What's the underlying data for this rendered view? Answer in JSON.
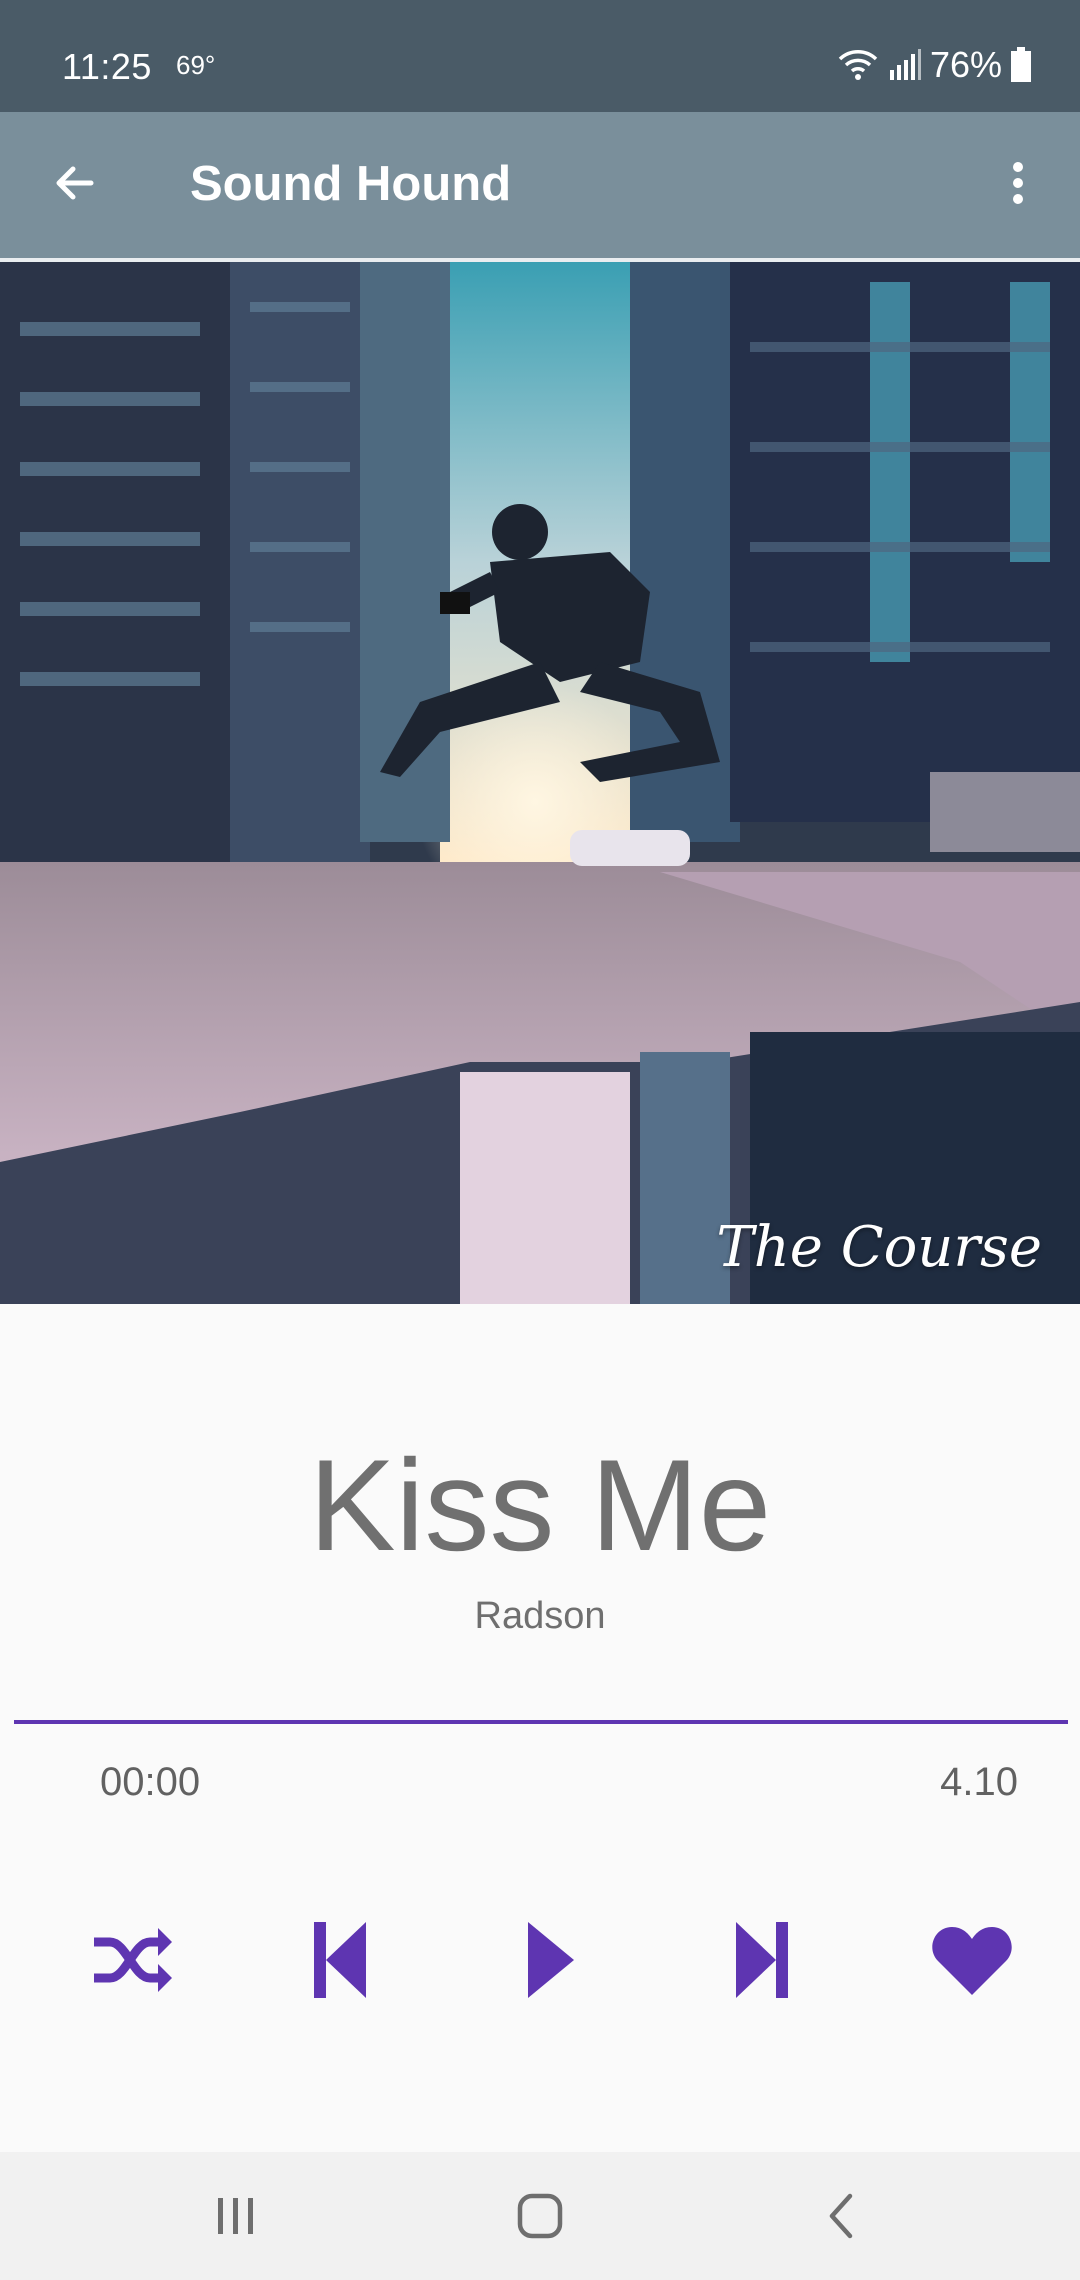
{
  "status_bar": {
    "time": "11:25",
    "temperature": "69°",
    "battery": "76%",
    "icons": [
      "wifi-icon",
      "signal-icon",
      "battery-icon"
    ]
  },
  "app_bar": {
    "title": "Sound Hound",
    "back_icon": "arrow-left-icon",
    "menu_icon": "more-vertical-icon",
    "background": "#7a8f9b"
  },
  "album": {
    "caption": "The Course"
  },
  "track": {
    "title": "Kiss Me",
    "artist": "Radson",
    "current_time": "00:00",
    "total_time": "4.10",
    "progress": 0
  },
  "controls": {
    "accent": "#5e35b1",
    "buttons": [
      "shuffle-icon",
      "skip-previous-icon",
      "play-icon",
      "skip-next-icon",
      "heart-icon"
    ]
  },
  "navigation": {
    "buttons": [
      "recent-apps-icon",
      "home-icon",
      "back-icon"
    ]
  }
}
